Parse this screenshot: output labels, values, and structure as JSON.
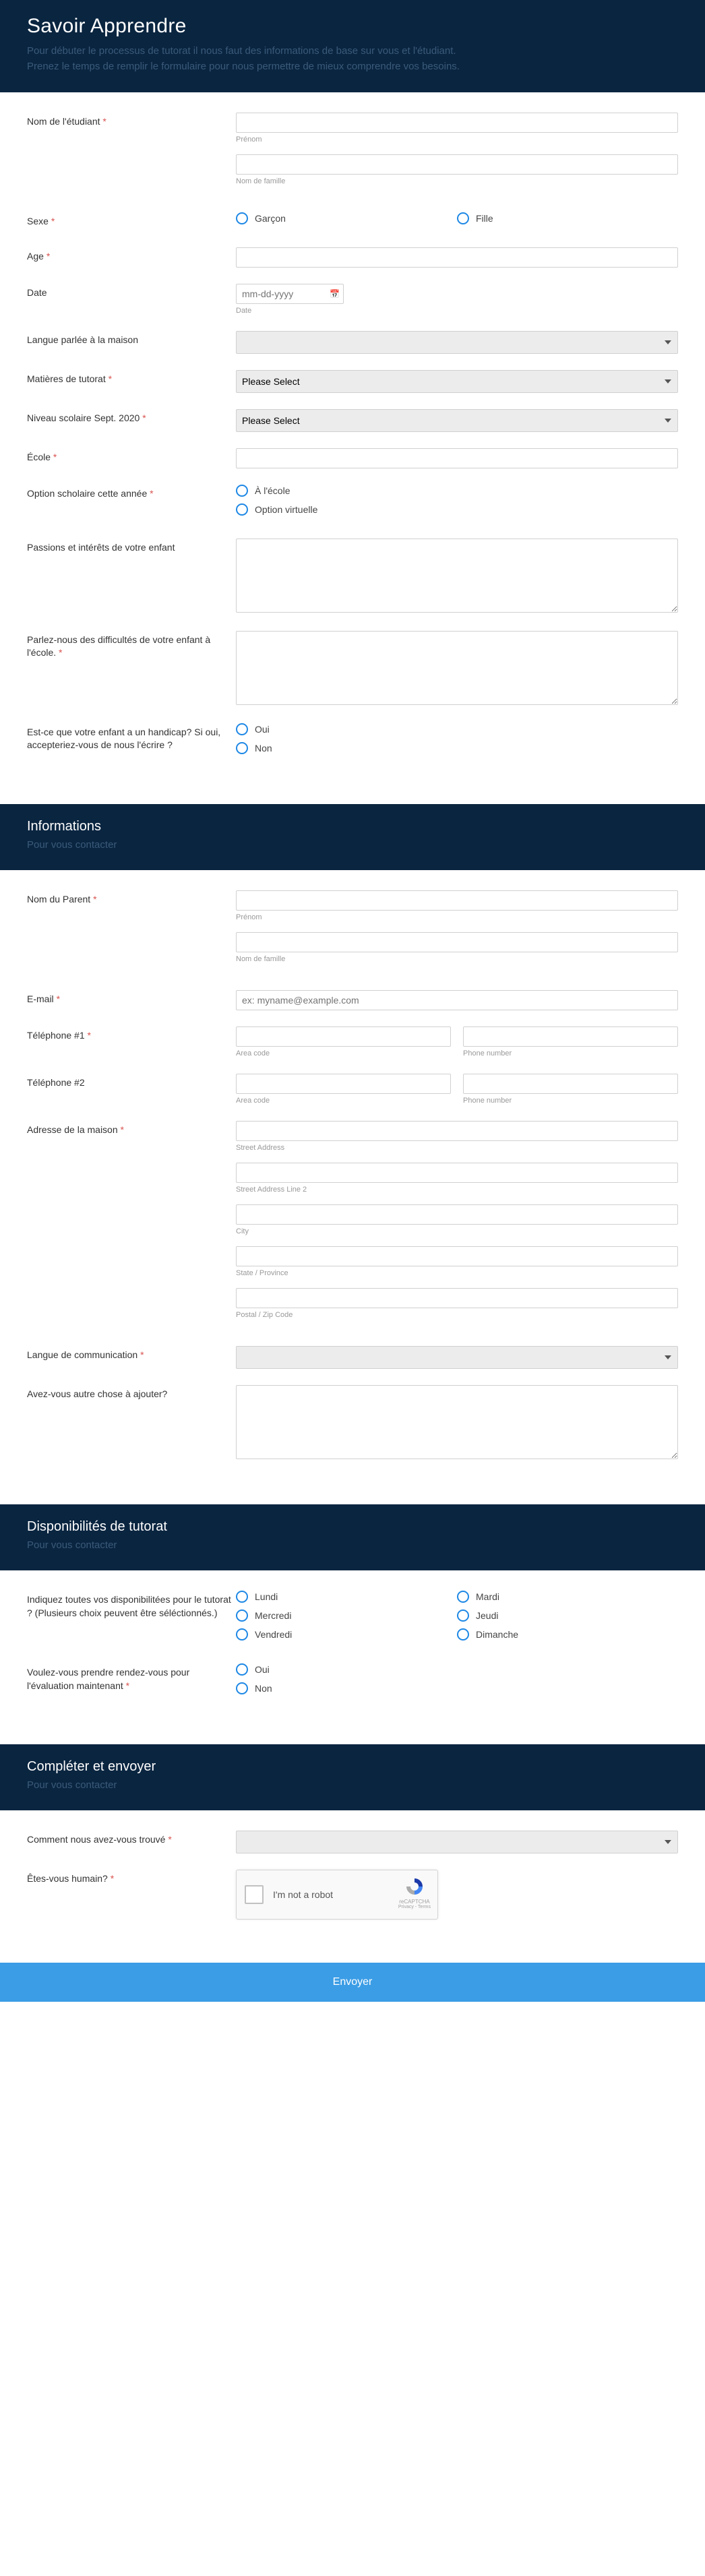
{
  "section1": {
    "title": "Savoir Apprendre",
    "desc_line1": "Pour débuter le processus de tutorat il nous faut des informations de base sur vous et l'étudiant.",
    "desc_line2": "Prenez le temps de remplir le formulaire pour nous permettre de mieux comprendre vos besoins.",
    "student_name_label": "Nom de l'étudiant",
    "first_name_sub": "Prénom",
    "last_name_sub": "Nom de famille",
    "gender_label": "Sexe",
    "gender_opts": [
      "Garçon",
      "Fille"
    ],
    "age_label": "Age",
    "date_label": "Date",
    "date_placeholder": "mm-dd-yyyy",
    "date_sub": "Date",
    "home_lang_label": "Langue parlée à la maison",
    "subjects_label": "Matières de tutorat",
    "grade_label": "Niveau scolaire Sept. 2020",
    "select_placeholder": "Please Select",
    "school_label": "École",
    "school_option_label": "Option scholaire cette année",
    "school_opts": [
      "À l'école",
      "Option virtuelle"
    ],
    "passions_label": "Passions et intérêts de votre enfant",
    "difficulties_label": "Parlez-nous des difficultés de votre enfant à l'école.",
    "handicap_label": "Est-ce que votre enfant a un handicap? Si oui, accepteriez-vous de nous l'écrire ?",
    "yesno": [
      "Oui",
      "Non"
    ]
  },
  "section2": {
    "title": "Informations",
    "subtitle": "Pour vous contacter",
    "parent_name_label": "Nom du  Parent",
    "first_name_sub": "Prénom",
    "last_name_sub": "Nom de famille",
    "email_label": "E-mail",
    "email_placeholder": "ex: myname@example.com",
    "phone1_label": "Téléphone #1",
    "phone2_label": "Téléphone #2",
    "area_code_sub": "Area code",
    "phone_num_sub": "Phone number",
    "address_label": "Adresse de la maison",
    "addr_subs": [
      "Street Address",
      "Street Address  Line 2",
      "City",
      "State /  Province",
      "Postal / Zip Code"
    ],
    "comm_lang_label": "Langue de communication",
    "other_label": "Avez-vous autre chose à ajouter?"
  },
  "section3": {
    "title": "Disponibilités de tutorat",
    "subtitle": "Pour vous contacter",
    "avail_label": "Indiquez toutes vos disponibilitées pour le tutorat ? (Plusieurs choix peuvent être séléctionnés.)",
    "days_col1": [
      "Lundi",
      "Mercredi",
      "Vendredi"
    ],
    "days_col2": [
      "Mardi",
      "Jeudi",
      "Dimanche"
    ],
    "appt_label": "Voulez-vous prendre rendez-vous pour l'évaluation maintenant",
    "yesno": [
      "Oui",
      "Non"
    ]
  },
  "section4": {
    "title": "Compléter et envoyer",
    "subtitle": "Pour vous contacter",
    "found_label": "Comment nous avez-vous trouvé",
    "human_label": "Êtes-vous humain?",
    "recaptcha_text": "I'm not a robot",
    "recaptcha_brand": "reCAPTCHA",
    "recaptcha_terms": "Privacy - Terms",
    "submit": "Envoyer"
  }
}
